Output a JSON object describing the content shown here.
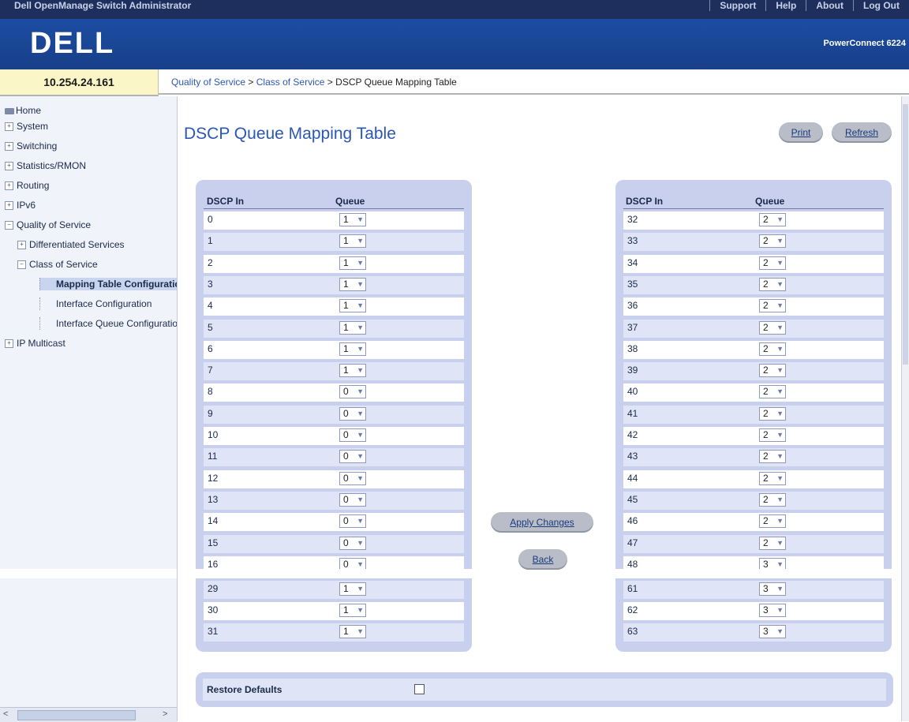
{
  "header": {
    "app_title": "Dell OpenManage Switch Administrator",
    "links": [
      "Support",
      "Help",
      "About",
      "Log Out"
    ],
    "logo": "DELL",
    "product": "PowerConnect 6224"
  },
  "ip_address": "10.254.24.161",
  "breadcrumb": {
    "items": [
      "Quality of Service",
      "Class of Service"
    ],
    "separator": ">",
    "current": "DSCP Queue Mapping Table"
  },
  "sidebar": {
    "items": [
      {
        "label": "Home",
        "expander": "",
        "indent": 0
      },
      {
        "label": "System",
        "expander": "+",
        "indent": 0
      },
      {
        "label": "Switching",
        "expander": "+",
        "indent": 0
      },
      {
        "label": "Statistics/RMON",
        "expander": "+",
        "indent": 0
      },
      {
        "label": "Routing",
        "expander": "+",
        "indent": 0
      },
      {
        "label": "IPv6",
        "expander": "+",
        "indent": 0
      },
      {
        "label": "Quality of Service",
        "expander": "−",
        "indent": 0
      },
      {
        "label": "Differentiated Services",
        "expander": "+",
        "indent": 1
      },
      {
        "label": "Class of Service",
        "expander": "−",
        "indent": 1
      },
      {
        "label": "Mapping Table Configuration",
        "expander": "",
        "indent": 2,
        "selected": true
      },
      {
        "label": "Interface Configuration",
        "expander": "",
        "indent": 2
      },
      {
        "label": "Interface Queue Configuration",
        "expander": "",
        "indent": 2
      },
      {
        "label": "IP Multicast",
        "expander": "+",
        "indent": 0
      }
    ]
  },
  "page_title": "DSCP Queue Mapping Table",
  "buttons": {
    "print": "Print",
    "refresh": "Refresh",
    "apply": "Apply Changes",
    "back": "Back"
  },
  "table_headers": {
    "dscp": "DSCP In",
    "queue": "Queue"
  },
  "left_table": [
    {
      "dscp": "0",
      "queue": "1"
    },
    {
      "dscp": "1",
      "queue": "1"
    },
    {
      "dscp": "2",
      "queue": "1"
    },
    {
      "dscp": "3",
      "queue": "1"
    },
    {
      "dscp": "4",
      "queue": "1"
    },
    {
      "dscp": "5",
      "queue": "1"
    },
    {
      "dscp": "6",
      "queue": "1"
    },
    {
      "dscp": "7",
      "queue": "1"
    },
    {
      "dscp": "8",
      "queue": "0"
    },
    {
      "dscp": "9",
      "queue": "0"
    },
    {
      "dscp": "10",
      "queue": "0"
    },
    {
      "dscp": "11",
      "queue": "0"
    },
    {
      "dscp": "12",
      "queue": "0"
    },
    {
      "dscp": "13",
      "queue": "0"
    },
    {
      "dscp": "14",
      "queue": "0"
    },
    {
      "dscp": "15",
      "queue": "0"
    },
    {
      "dscp": "16",
      "queue": "0"
    }
  ],
  "left_table_tail": [
    {
      "dscp": "29",
      "queue": "1"
    },
    {
      "dscp": "30",
      "queue": "1"
    },
    {
      "dscp": "31",
      "queue": "1"
    }
  ],
  "right_table": [
    {
      "dscp": "32",
      "queue": "2"
    },
    {
      "dscp": "33",
      "queue": "2"
    },
    {
      "dscp": "34",
      "queue": "2"
    },
    {
      "dscp": "35",
      "queue": "2"
    },
    {
      "dscp": "36",
      "queue": "2"
    },
    {
      "dscp": "37",
      "queue": "2"
    },
    {
      "dscp": "38",
      "queue": "2"
    },
    {
      "dscp": "39",
      "queue": "2"
    },
    {
      "dscp": "40",
      "queue": "2"
    },
    {
      "dscp": "41",
      "queue": "2"
    },
    {
      "dscp": "42",
      "queue": "2"
    },
    {
      "dscp": "43",
      "queue": "2"
    },
    {
      "dscp": "44",
      "queue": "2"
    },
    {
      "dscp": "45",
      "queue": "2"
    },
    {
      "dscp": "46",
      "queue": "2"
    },
    {
      "dscp": "47",
      "queue": "2"
    },
    {
      "dscp": "48",
      "queue": "3"
    }
  ],
  "right_table_tail": [
    {
      "dscp": "61",
      "queue": "3"
    },
    {
      "dscp": "62",
      "queue": "3"
    },
    {
      "dscp": "63",
      "queue": "3"
    }
  ],
  "restore_defaults": {
    "label": "Restore Defaults",
    "checked": false
  },
  "colors": {
    "banner": "#1c4da3",
    "panel": "#c8d0ee",
    "link": "#2a57b5",
    "ip_bg": "#fbf6c8"
  }
}
